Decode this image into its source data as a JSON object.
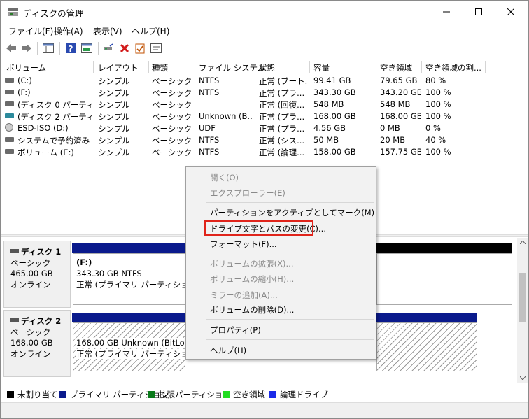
{
  "window": {
    "title": "ディスクの管理"
  },
  "menubar": [
    "ファイル(F)",
    "操作(A)",
    "表示(V)",
    "ヘルプ(H)"
  ],
  "toolbar": {
    "icons": [
      "back-icon",
      "forward-icon",
      "console-tree-icon",
      "help-icon",
      "properties-icon",
      "connect-icon",
      "delete-icon",
      "check-icon",
      "settings-icon"
    ]
  },
  "columns": [
    "ボリューム",
    "レイアウト",
    "種類",
    "ファイル システム",
    "状態",
    "容量",
    "空き領域",
    "空き領域の割..."
  ],
  "volumes": [
    {
      "name": "(C:)",
      "layout": "シンプル",
      "type": "ベーシック",
      "fs": "NTFS",
      "status": "正常 (ブート...",
      "capacity": "99.41 GB",
      "free": "79.65 GB",
      "pct": "80 %"
    },
    {
      "name": "(F:)",
      "layout": "シンプル",
      "type": "ベーシック",
      "fs": "NTFS",
      "status": "正常 (プラ...",
      "capacity": "343.30 GB",
      "free": "343.20 GB",
      "pct": "100 %"
    },
    {
      "name": "(ディスク 0 パーティシ...",
      "layout": "シンプル",
      "type": "ベーシック",
      "fs": "",
      "status": "正常 (回復...",
      "capacity": "548 MB",
      "free": "548 MB",
      "pct": "100 %"
    },
    {
      "name": "(ディスク 2 パーティシ...",
      "layout": "シンプル",
      "type": "ベーシック",
      "fs": "Unknown (B...",
      "status": "正常 (プラ...",
      "capacity": "168.00 GB",
      "free": "168.00 GB",
      "pct": "100 %"
    },
    {
      "name": "ESD-ISO (D:)",
      "layout": "シンプル",
      "type": "ベーシック",
      "fs": "UDF",
      "status": "正常 (プラ...",
      "capacity": "4.56 GB",
      "free": "0 MB",
      "pct": "0 %"
    },
    {
      "name": "システムで予約済み",
      "layout": "シンプル",
      "type": "ベーシック",
      "fs": "NTFS",
      "status": "正常 (シス...",
      "capacity": "50 MB",
      "free": "20 MB",
      "pct": "40 %"
    },
    {
      "name": "ボリューム (E:)",
      "layout": "シンプル",
      "type": "ベーシック",
      "fs": "NTFS",
      "status": "正常 (論理...",
      "capacity": "158.00 GB",
      "free": "157.75 GB",
      "pct": "100 %"
    }
  ],
  "disks": [
    {
      "name": "ディスク 1",
      "type": "ベーシック",
      "size": "465.00 GB",
      "state": "オンライン",
      "partition": {
        "title": "(F:)",
        "detail": "343.30 GB NTFS",
        "status": "正常 (プライマリ パーティション)"
      }
    },
    {
      "name": "ディスク 2",
      "type": "ベーシック",
      "size": "168.00 GB",
      "state": "オンライン",
      "partition": {
        "title": "",
        "detail": "168.00 GB Unknown (BitLocker",
        "status": "正常 (プライマリ パーティション)"
      }
    }
  ],
  "legend": [
    {
      "label": "未割り当て",
      "color": "#000000"
    },
    {
      "label": "プライマリ パーティション",
      "color": "#0a1a8c"
    },
    {
      "label": "拡張パーティション",
      "color": "#0a7a1a"
    },
    {
      "label": "空き領域",
      "color": "#22dd22"
    },
    {
      "label": "論理ドライブ",
      "color": "#1a2ae8"
    }
  ],
  "context_menu": [
    {
      "label": "開く(O)",
      "enabled": false
    },
    {
      "label": "エクスプローラー(E)",
      "enabled": false
    },
    {
      "label": "パーティションをアクティブとしてマーク(M)",
      "enabled": true
    },
    {
      "label": "ドライブ文字とパスの変更(C)...",
      "enabled": true,
      "highlighted": true
    },
    {
      "label": "フォーマット(F)...",
      "enabled": true
    },
    {
      "label": "ボリュームの拡張(X)...",
      "enabled": false
    },
    {
      "label": "ボリュームの縮小(H)...",
      "enabled": false
    },
    {
      "label": "ミラーの追加(A)...",
      "enabled": false
    },
    {
      "label": "ボリュームの削除(D)...",
      "enabled": true
    },
    {
      "label": "プロパティ(P)",
      "enabled": true
    },
    {
      "label": "ヘルプ(H)",
      "enabled": true
    }
  ]
}
